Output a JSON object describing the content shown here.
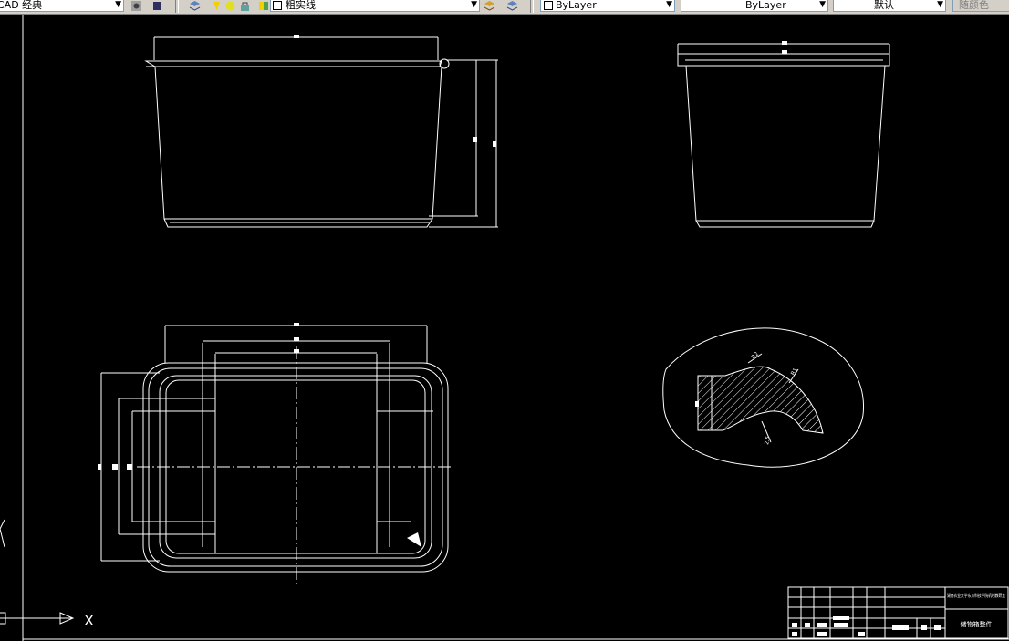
{
  "toolbar": {
    "workspace_combo": "CAD 经典",
    "layer_combo": "粗实线",
    "color_combo": "ByLayer",
    "linetype_combo": "ByLayer",
    "lineweight_combo": "默认",
    "plotstyle_combo": "随颜色"
  },
  "drawing": {
    "ucs_x_label": "X",
    "title_block": {
      "company": "湖南农业大学东方科技学院机制教研室",
      "part_name": "储物箱整件"
    },
    "section_dims": [
      "R2",
      "R1",
      "2.5",
      "4"
    ]
  },
  "colors": {
    "canvas_bg": "#000000",
    "line": "#ffffff",
    "toolbar_bg": "#d4d0c8"
  }
}
